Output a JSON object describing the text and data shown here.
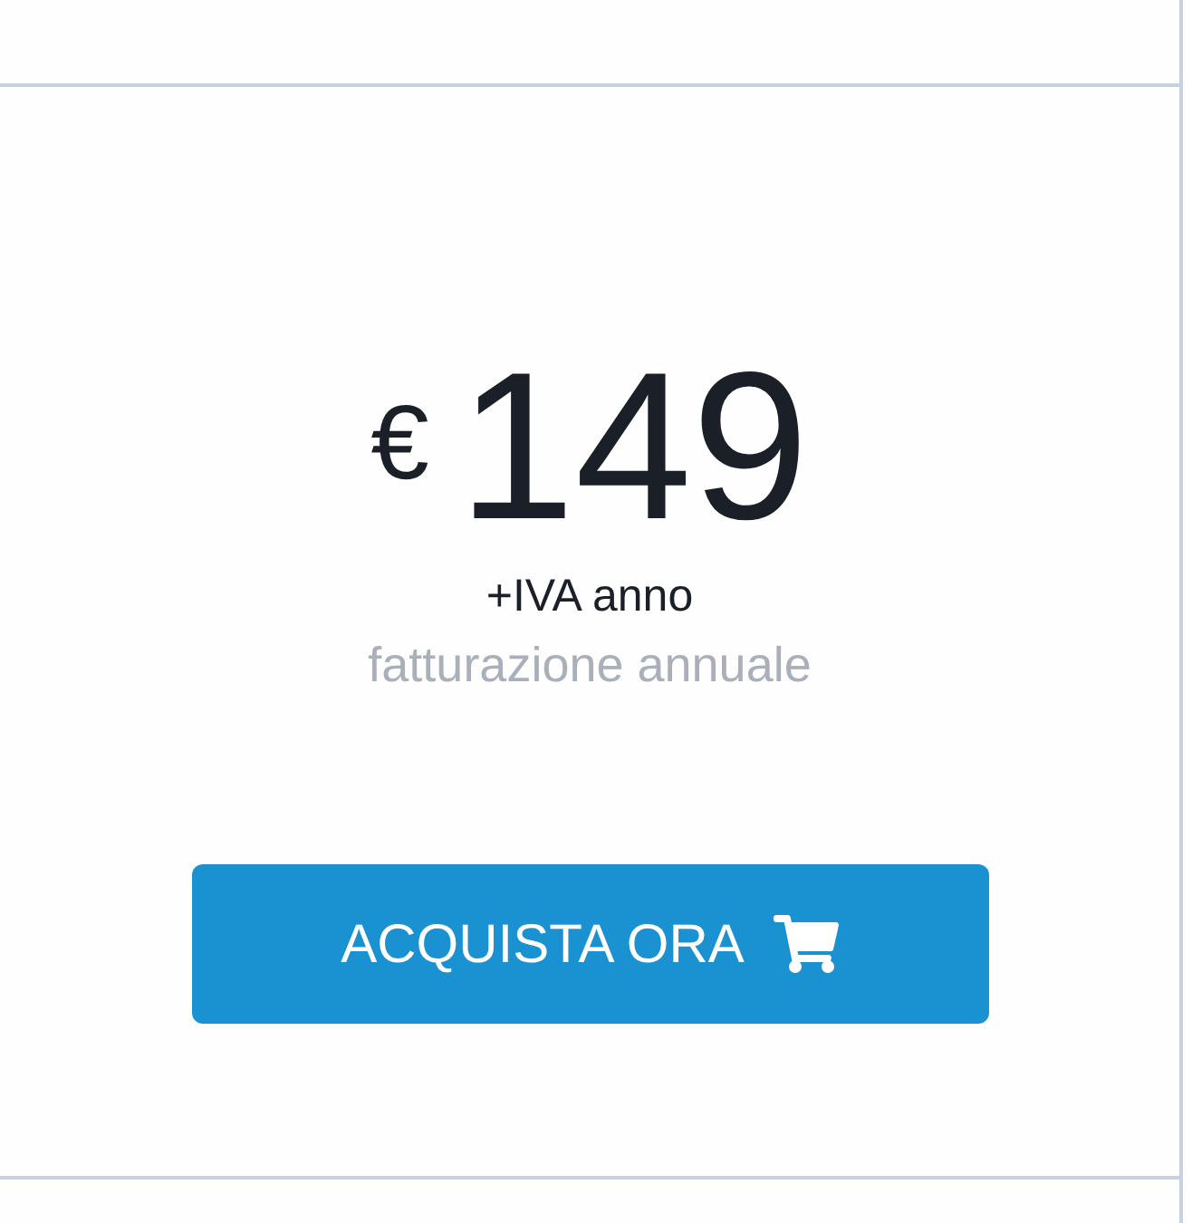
{
  "price": {
    "currency": "€",
    "amount": "149",
    "period": "+IVA anno",
    "billing": "fatturazione annuale"
  },
  "buy_button": {
    "label": "ACQUISTA ORA"
  }
}
